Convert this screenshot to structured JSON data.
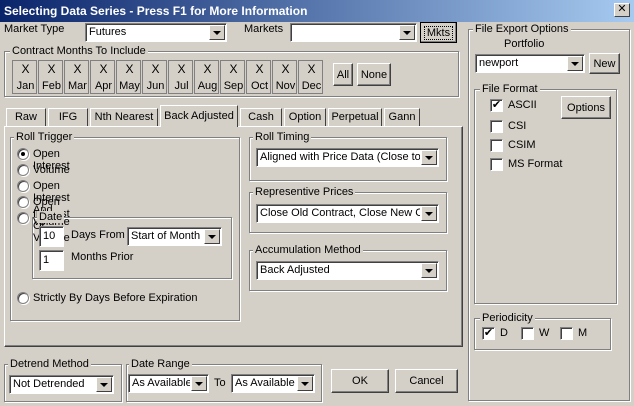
{
  "window": {
    "title": "Selecting Data Series - Press F1 for More Information",
    "close_glyph": "✕"
  },
  "market_type": {
    "label": "Market Type",
    "value": "Futures"
  },
  "markets": {
    "label": "Markets",
    "value": "",
    "button": "Mkts"
  },
  "contract_months": {
    "label": "Contract Months To Include",
    "months": [
      {
        "label": "Jan",
        "mark": "X"
      },
      {
        "label": "Feb",
        "mark": "X"
      },
      {
        "label": "Mar",
        "mark": "X"
      },
      {
        "label": "Apr",
        "mark": "X"
      },
      {
        "label": "May",
        "mark": "X"
      },
      {
        "label": "Jun",
        "mark": "X"
      },
      {
        "label": "Jul",
        "mark": "X"
      },
      {
        "label": "Aug",
        "mark": "X"
      },
      {
        "label": "Sep",
        "mark": "X"
      },
      {
        "label": "Oct",
        "mark": "X"
      },
      {
        "label": "Nov",
        "mark": "X"
      },
      {
        "label": "Dec",
        "mark": "X"
      }
    ],
    "all_button": "All",
    "none_button": "None"
  },
  "tabs": [
    "Raw",
    "IFG",
    "Nth Nearest",
    "Back Adjusted",
    "Cash",
    "Option",
    "Perpetual",
    "Gann"
  ],
  "active_tab": "Back Adjusted",
  "roll_trigger": {
    "label": "Roll Trigger",
    "options": [
      "Open Interest",
      "Volume",
      "Open Interest And Volume",
      "Open Interest Or Volume"
    ],
    "selected": "Open Interest",
    "date_option": "Date",
    "days_value": "10",
    "days_from_label": "Days From",
    "days_from_select": "Start of Month",
    "months_value": "1",
    "months_prior_label": "Months Prior",
    "strict_option": "Strictly By Days Before Expiration"
  },
  "roll_timing": {
    "label": "Roll Timing",
    "value": "Aligned with Price Data (Close to C"
  },
  "representative_prices": {
    "label": "Representive Prices",
    "value": "Close Old Contract, Close New Co"
  },
  "accumulation_method": {
    "label": "Accumulation Method",
    "value": "Back Adjusted"
  },
  "detrend_method": {
    "label": "Detrend Method",
    "value": "Not Detrended"
  },
  "date_range": {
    "label": "Date Range",
    "from": "As Available",
    "to_label": "To",
    "to": "As Available"
  },
  "buttons": {
    "ok": "OK",
    "cancel": "Cancel"
  },
  "file_export": {
    "label": "File Export Options",
    "portfolio_label": "Portfolio",
    "portfolio_value": "newport",
    "new_button": "New",
    "file_format": {
      "label": "File Format",
      "options": [
        {
          "label": "ASCII",
          "checked": true
        },
        {
          "label": "CSI",
          "checked": false
        },
        {
          "label": "CSIM",
          "checked": false
        },
        {
          "label": "MS Format",
          "checked": false
        }
      ],
      "options_button": "Options"
    },
    "periodicity": {
      "label": "Periodicity",
      "options": [
        {
          "label": "D",
          "checked": true
        },
        {
          "label": "W",
          "checked": false
        },
        {
          "label": "M",
          "checked": false
        }
      ]
    }
  },
  "check_glyph": "✔"
}
